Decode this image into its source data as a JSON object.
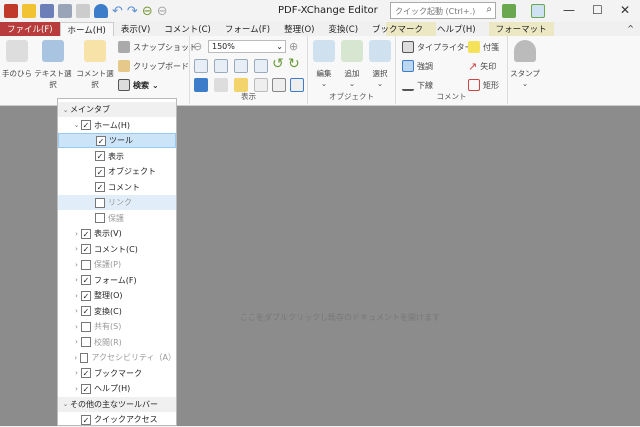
{
  "window": {
    "title": "PDF-XChange Editor",
    "search_placeholder": "クイック起動 (Ctrl+.)"
  },
  "tabs": [
    {
      "label": "ファイル(F)",
      "kind": "file"
    },
    {
      "label": "ホーム(H)",
      "kind": "active"
    },
    {
      "label": "表示(V)"
    },
    {
      "label": "コメント(C)"
    },
    {
      "label": "フォーム(F)"
    },
    {
      "label": "整理(O)"
    },
    {
      "label": "変換(C)"
    },
    {
      "label": "ブックマーク"
    },
    {
      "label": "ヘルプ(H)"
    },
    {
      "label": "フォーマット",
      "kind": "fmt"
    }
  ],
  "ribbon": {
    "hand": "手のひら",
    "text_select": "テキスト選択",
    "comment_select": "コメント選択",
    "snapshot": "スナップショット",
    "clipboard": "クリップボード",
    "search": "検索",
    "zoom": "150%",
    "view_group": "表示",
    "edit": "編集",
    "add": "追加",
    "select": "選択",
    "object_group": "オブジェクト",
    "typewriter": "タイプライター",
    "highlight": "強調",
    "underline": "下線",
    "note": "付箋",
    "arrow": "矢印",
    "rect": "矩形",
    "comment_group": "コメント",
    "stamp": "スタンプ"
  },
  "workspace": {
    "hint": "ここをダブルクリックし既存のドキュメントを開けます"
  },
  "panel": {
    "rows": [
      {
        "label": "メインタブ",
        "level": 0,
        "type": "section"
      },
      {
        "label": "ホーム(H)",
        "level": 1,
        "checked": true,
        "expand": "open"
      },
      {
        "label": "ツール",
        "level": 2,
        "checked": true,
        "state": "selected"
      },
      {
        "label": "表示",
        "level": 2,
        "checked": true
      },
      {
        "label": "オブジェクト",
        "level": 2,
        "checked": true
      },
      {
        "label": "コメント",
        "level": 2,
        "checked": true
      },
      {
        "label": "リンク",
        "level": 2,
        "checked": false,
        "state": "hover",
        "disabled": true
      },
      {
        "label": "保護",
        "level": 2,
        "checked": false,
        "disabled": true
      },
      {
        "label": "表示(V)",
        "level": 1,
        "checked": true,
        "expand": "closed"
      },
      {
        "label": "コメント(C)",
        "level": 1,
        "checked": true,
        "expand": "closed"
      },
      {
        "label": "保護(P)",
        "level": 1,
        "checked": false,
        "expand": "closed",
        "disabled": true
      },
      {
        "label": "フォーム(F)",
        "level": 1,
        "checked": true,
        "expand": "closed"
      },
      {
        "label": "整理(O)",
        "level": 1,
        "checked": true,
        "expand": "closed"
      },
      {
        "label": "変換(C)",
        "level": 1,
        "checked": true,
        "expand": "closed"
      },
      {
        "label": "共有(S)",
        "level": 1,
        "checked": false,
        "expand": "closed",
        "disabled": true
      },
      {
        "label": "校閲(R)",
        "level": 1,
        "checked": false,
        "expand": "closed",
        "disabled": true
      },
      {
        "label": "アクセシビリティ（A）",
        "level": 1,
        "checked": false,
        "expand": "closed",
        "disabled": true
      },
      {
        "label": "ブックマーク",
        "level": 1,
        "checked": true,
        "expand": "closed"
      },
      {
        "label": "ヘルプ(H)",
        "level": 1,
        "checked": true,
        "expand": "closed"
      },
      {
        "label": "その他の主なツールバー",
        "level": 0,
        "type": "section"
      },
      {
        "label": "クイックアクセス",
        "level": 1,
        "checked": true
      }
    ]
  },
  "colors": {
    "file_tab": "#b83c3c",
    "format_tab": "#ece8c4",
    "selection": "#cce4f7",
    "workspace": "#8c8c8c"
  }
}
